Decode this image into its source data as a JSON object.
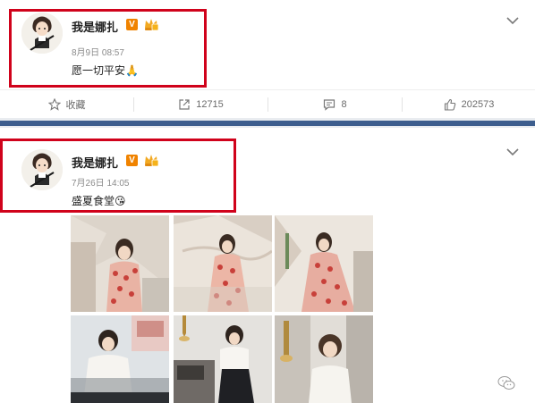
{
  "posts": [
    {
      "author": "我是娜扎",
      "verified_badge": "V",
      "time": "8月9日 08:57",
      "content": "愿一切平安🙏",
      "actions": {
        "favorite_label": "收藏",
        "repost_count": "12715",
        "comment_count": "8",
        "like_count": "202573"
      }
    },
    {
      "author": "我是娜扎",
      "verified_badge": "V",
      "time": "7月26日 14:05",
      "content": "盛夏食堂😘",
      "photos": [
        "photo-1",
        "photo-2",
        "photo-3",
        "photo-4",
        "photo-5",
        "photo-6"
      ]
    }
  ],
  "icons": {
    "favorite": "star-icon",
    "repost": "share-icon",
    "comment": "comment-icon",
    "like": "thumbs-up-icon",
    "menu": "chevron-down-icon",
    "crown": "crown-badge-icon"
  },
  "colors": {
    "highlight_box": "#d0021b",
    "divider_bar": "#3d5e8e",
    "verified": "#f08300"
  }
}
